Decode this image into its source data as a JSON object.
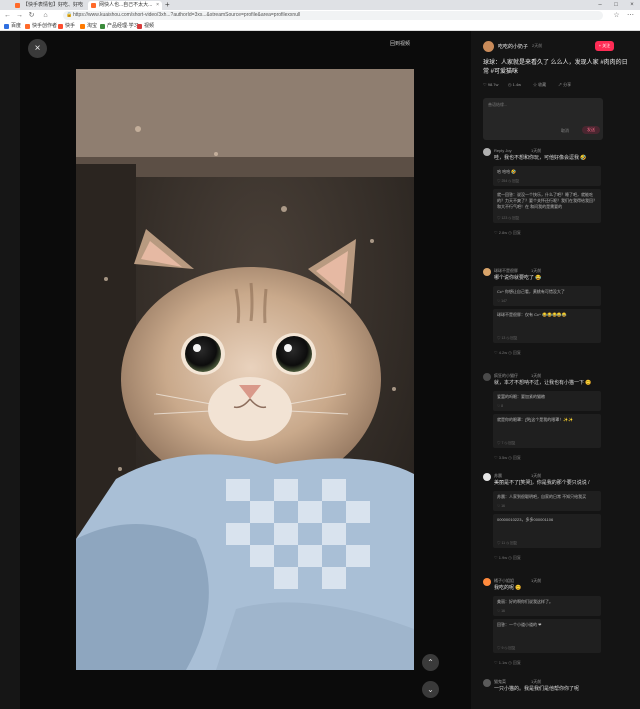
{
  "browser": {
    "tabs": [
      {
        "title": "【快手表情包】好吃、好吃"
      },
      {
        "title": "网快人也...自己不太大..."
      }
    ],
    "url": "https://www.kuaishou.com/short-video/3xh...?authorId=3xs...&streamSource=profile&area=profilexxnull",
    "bookmarks": [
      {
        "label": "百度",
        "color": "#2f6fe0"
      },
      {
        "label": "快手创作者",
        "color": "#ff6a2a"
      },
      {
        "label": "快手",
        "color": "#ff4d2e"
      },
      {
        "label": "淘宝",
        "color": "#ff7a00"
      },
      {
        "label": "产品经理·学习",
        "color": "#3b8b3b"
      },
      {
        "label": "视频",
        "color": "#d83b3b"
      }
    ]
  },
  "viewer": {
    "original_link": "回到视频",
    "close_icon": "×",
    "up_icon": "⌃",
    "down_icon": "⌄",
    "expand_icon": "›"
  },
  "post": {
    "author_name": "吃吃的小奶子",
    "time": "2天前",
    "follow_label": "+ 关注",
    "description": "球球：人家就是来看久了 么么人，发现人家 #肉肉的日常 #可爱猫咪",
    "stats": [
      {
        "icon": "♡",
        "value": "98.7w"
      },
      {
        "icon": "◷",
        "value": "1.4w"
      },
      {
        "icon": "☆",
        "value": "收藏"
      },
      {
        "icon": "↗",
        "value": "分享"
      }
    ],
    "comment_placeholder": "善语结缘...",
    "cancel_label": "取消",
    "send_label": "发送"
  },
  "comments": [
    {
      "name": "Reply Joy",
      "time": "1天前",
      "avatar_color": "#b0b0b0",
      "text": "哇，我也不想和你玩，可他好像会逗我 🤣",
      "replies": [
        {
          "text": "哈 哈哈 🤣",
          "meta": "♡ 254    ◷ 回复"
        },
        {
          "text": "就一回答：说没一个快乐，什么了吧？睡了吧，就能吃的？力天不爽了？要个关怀还行呢？我们在我得给我回？和大不行气吧！在 和问我的是需要的",
          "meta": "♡ 123    ◷ 回复"
        }
      ],
      "meta": "♡ 2.8w    ◷ 回复"
    },
    {
      "name": "球球不是很胖",
      "time": "1天前",
      "avatar_color": "#d9a46a",
      "text": "哪个说你就要吃了 😂",
      "replies": [
        {
          "text": "Cc^ 你想让自己看，黄桃有可惜没大了",
          "meta": "♡ 147"
        },
        {
          "text": "球球不是很胖：仅有 Cc^ 😂😂😂😂😂",
          "meta": "♡ 13    ◷ 回复"
        }
      ],
      "meta": "♡ 4.2w    ◷ 回复"
    },
    {
      "name": "疯狂的小猫仔",
      "time": "1天前",
      "avatar_color": "#4a4a4a",
      "text": "就，本才不想呐不过，让我也有小猫一下 😊",
      "replies": [
        {
          "text": "爱罢的吗眼：要加紧的猫粮",
          "meta": "♡ 8"
        },
        {
          "text": "就是你的眼罩：[哭]这个是我的眼罩！✨✨",
          "meta": "♡ 7    ◷ 回复"
        }
      ],
      "meta": "♡ 3.5w    ◷ 回复"
    },
    {
      "name": "苏晨",
      "time": "1天前",
      "avatar_color": "#e6e6e6",
      "text": "美丽是不了[笑哭]，你是我的那个要只说说 /",
      "replies": [
        {
          "text": "苏晨：人家到很聪明吧，自家的日常 不知只给我买",
          "meta": "♡ 16"
        },
        {
          "text": "00000010223，多多000001106",
          "meta": "♡ 11    ◷ 回复"
        }
      ],
      "meta": "♡ 1.9w    ◷ 回复"
    },
    {
      "name": "橘子小姐姐",
      "time": "1天前",
      "avatar_color": "#ff8a3d",
      "text": "我吃的呢 😊",
      "replies": [
        {
          "text": "美丽：好的啊你们说我这样了。",
          "meta": "♡ 16"
        },
        {
          "text": "回答：一个小道小道的 ❤",
          "meta": "♡ 9    ◷ 回复"
        }
      ],
      "meta": "♡ 1.1w    ◷ 回复"
    },
    {
      "name": "猫鬼菜",
      "time": "1天前",
      "avatar_color": "#5a5a5a",
      "text": "一只小猫的。我是我们是他帮你你了呢",
      "replies": [],
      "meta": ""
    }
  ]
}
